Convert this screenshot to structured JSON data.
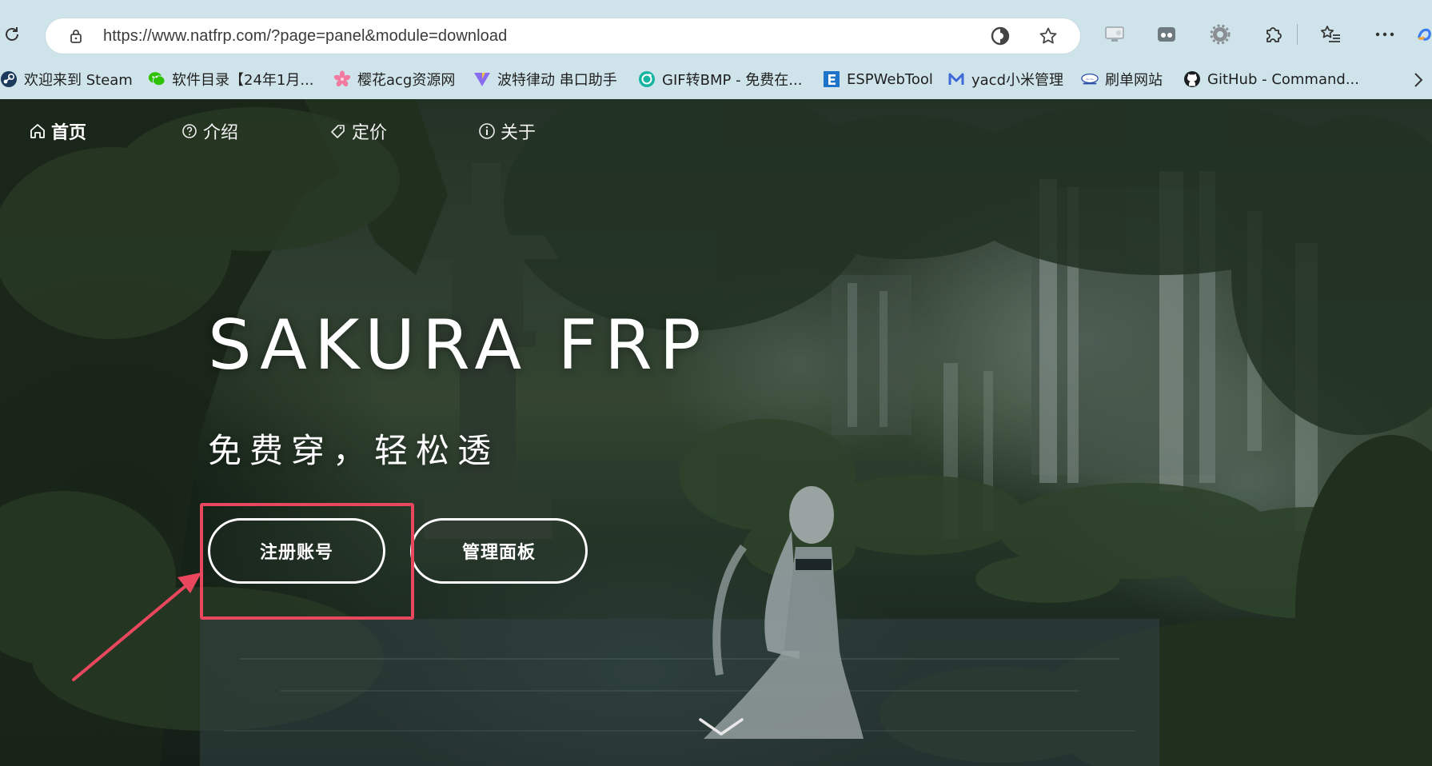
{
  "browser": {
    "url": "https://www.natfrp.com/?page=panel&module=download",
    "accent": "#e8475d"
  },
  "bookmarks": [
    {
      "label": "欢迎来到 Steam",
      "icon": "steam-icon"
    },
    {
      "label": "软件目录【24年1月...",
      "icon": "wechat-icon"
    },
    {
      "label": "樱花acg资源网",
      "icon": "sakura-icon"
    },
    {
      "label": "波特律动 串口助手",
      "icon": "vite-icon"
    },
    {
      "label": "GIF转BMP - 免费在...",
      "icon": "convert-icon"
    },
    {
      "label": "ESPWebTool",
      "icon": "esp-icon"
    },
    {
      "label": "yacd小米管理",
      "icon": "yacd-icon"
    },
    {
      "label": "刷单网站",
      "icon": "site-icon"
    },
    {
      "label": "GitHub - Command...",
      "icon": "github-icon"
    }
  ],
  "site": {
    "nav": [
      {
        "label": "首页",
        "icon": "home-icon"
      },
      {
        "label": "介绍",
        "icon": "help-circle-icon"
      },
      {
        "label": "定价",
        "icon": "tag-icon"
      },
      {
        "label": "关于",
        "icon": "info-icon"
      }
    ],
    "hero": {
      "title": "SAKURA FRP",
      "subtitle": "免费穿，轻松透",
      "register_label": "注册账号",
      "panel_label": "管理面板"
    }
  }
}
